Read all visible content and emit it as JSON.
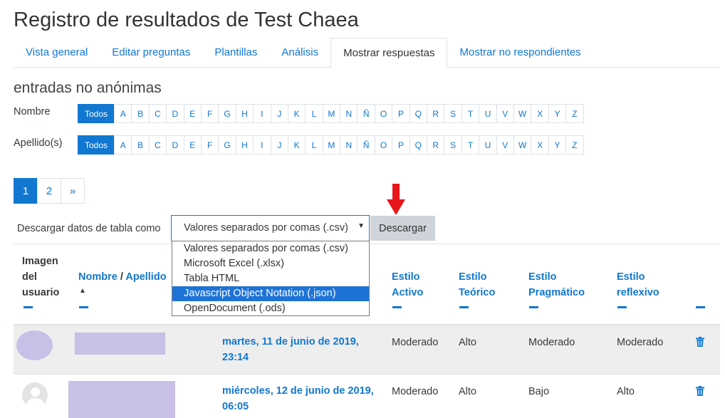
{
  "page": {
    "title": "Registro de resultados de Test Chaea",
    "subtitle": "entradas no anónimas"
  },
  "tabs": [
    {
      "label": "Vista general",
      "active": false
    },
    {
      "label": "Editar preguntas",
      "active": false
    },
    {
      "label": "Plantillas",
      "active": false
    },
    {
      "label": "Análisis",
      "active": false
    },
    {
      "label": "Mostrar respuestas",
      "active": true
    },
    {
      "label": "Mostrar no respondientes",
      "active": false
    }
  ],
  "filters": {
    "first_name": {
      "label": "Nombre",
      "all": "Todos"
    },
    "last_name": {
      "label": "Apellido(s)",
      "all": "Todos"
    },
    "letters": [
      "A",
      "B",
      "C",
      "D",
      "E",
      "F",
      "G",
      "H",
      "I",
      "J",
      "K",
      "L",
      "M",
      "N",
      "Ñ",
      "O",
      "P",
      "Q",
      "R",
      "S",
      "T",
      "U",
      "V",
      "W",
      "X",
      "Y",
      "Z"
    ]
  },
  "pagination": {
    "pages": [
      "1",
      "2"
    ],
    "current": "1",
    "next": "»"
  },
  "download": {
    "label": "Descargar datos de tabla como",
    "selected": "Valores separados por comas (.csv)",
    "button": "Descargar",
    "options": [
      "Valores separados por comas (.csv)",
      "Microsoft Excel (.xlsx)",
      "Tabla HTML",
      "Javascript Object Notation (.json)",
      "OpenDocument (.ods)"
    ],
    "highlighted_option": "Javascript Object Notation (.json)"
  },
  "table": {
    "headers": {
      "image": "Imagen del usuario",
      "name": "Nombre",
      "name_sep": " / ",
      "surname": "Apellido",
      "sort_indicator": "▲",
      "activo": "Estilo Activo",
      "teorico": "Estilo Teórico",
      "pragmatico": "Estilo Pragmático",
      "reflexivo": "Estilo reflexivo"
    },
    "rows": [
      {
        "date": "martes, 11 de junio de 2019, 23:14",
        "activo": "Moderado",
        "teorico": "Alto",
        "pragmatico": "Moderado",
        "reflexivo": "Moderado"
      },
      {
        "date": "miércoles, 12 de junio de 2019, 06:05",
        "activo": "Moderado",
        "teorico": "Alto",
        "pragmatico": "Bajo",
        "reflexivo": "Alto"
      }
    ]
  },
  "colors": {
    "link": "#1177d1",
    "highlight": "#1e73d6",
    "redaction": "#c8c0e6",
    "arrow": "#e8161b"
  },
  "icons": {
    "delete": "trash-icon",
    "arrow": "red-down-arrow-annotation"
  }
}
